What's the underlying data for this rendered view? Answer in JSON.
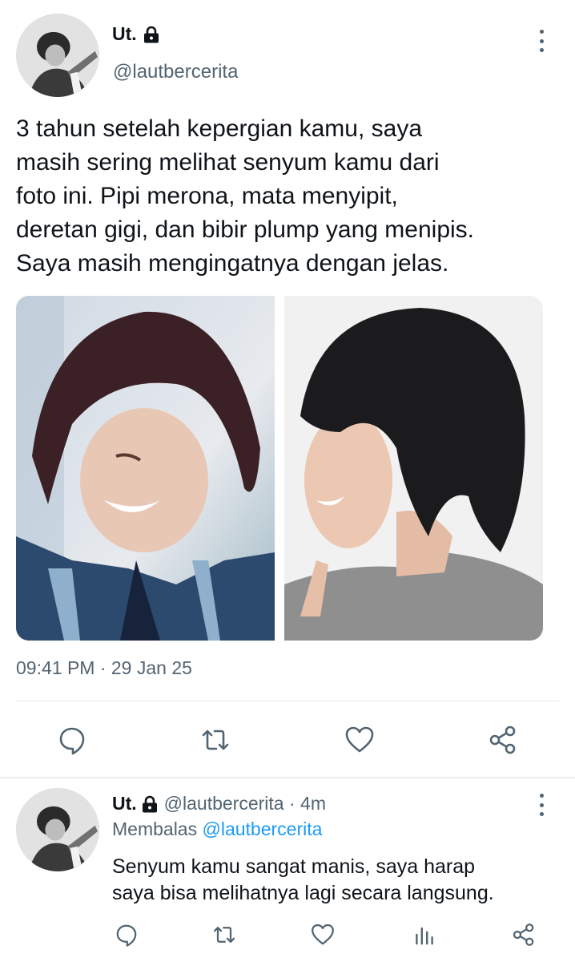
{
  "tweet": {
    "author": {
      "display_name": "Ut.",
      "handle": "@lautbercerita",
      "protected_icon": "lock-icon"
    },
    "text_lines": [
      "3 tahun setelah kepergian kamu, saya",
      "masih sering melihat senyum kamu dari",
      "foto ini. Pipi merona, mata menyipit,",
      "deretan gigi, dan bibir plump yang menipis.",
      "Saya masih mengingatnya dengan jelas."
    ],
    "timestamp": "09:41 PM · 29 Jan 25",
    "actions": [
      "reply-icon",
      "retweet-icon",
      "like-icon",
      "share-icon"
    ]
  },
  "reply": {
    "author": {
      "display_name": "Ut.",
      "protected_icon": "lock-icon"
    },
    "meta": "@lautbercerita · 4m",
    "replying_label": "Membalas",
    "replying_to": "@lautbercerita",
    "text_lines": [
      "Senyum kamu sangat manis, saya harap",
      "saya bisa melihatnya lagi secara langsung."
    ],
    "actions": [
      "reply-icon",
      "retweet-icon",
      "like-icon",
      "analytics-icon",
      "share-icon"
    ]
  },
  "colors": {
    "text": "#0f1419",
    "secondary": "#536471",
    "link": "#1d9bf0",
    "divider": "#e1e6ea"
  }
}
